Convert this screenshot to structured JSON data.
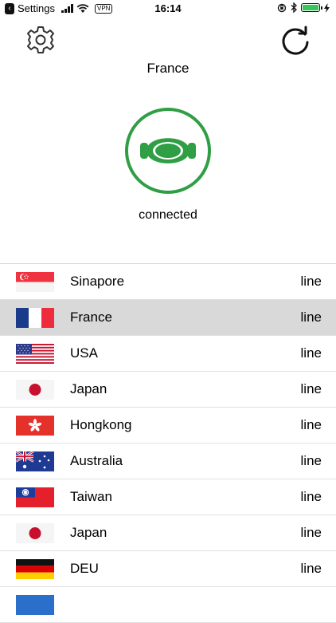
{
  "status_bar": {
    "back_app": "Settings",
    "vpn": "VPN",
    "time": "16:14"
  },
  "header": {
    "selected_country": "France"
  },
  "connection": {
    "status": "connected",
    "accent_color": "#2f9e44"
  },
  "servers": [
    {
      "name": "Sinapore",
      "status": "line",
      "flag": "singapore-flag-icon",
      "selected": false
    },
    {
      "name": "France",
      "status": "line",
      "flag": "france-flag-icon",
      "selected": true
    },
    {
      "name": "USA",
      "status": "line",
      "flag": "usa-flag-icon",
      "selected": false
    },
    {
      "name": "Japan",
      "status": "line",
      "flag": "japan-flag-icon",
      "selected": false
    },
    {
      "name": "Hongkong",
      "status": "line",
      "flag": "hongkong-flag-icon",
      "selected": false
    },
    {
      "name": "Australia",
      "status": "line",
      "flag": "australia-flag-icon",
      "selected": false
    },
    {
      "name": "Taiwan",
      "status": "line",
      "flag": "taiwan-flag-icon",
      "selected": false
    },
    {
      "name": "Japan",
      "status": "line",
      "flag": "japan-flag-icon",
      "selected": false
    },
    {
      "name": "DEU",
      "status": "line",
      "flag": "germany-flag-icon",
      "selected": false
    }
  ]
}
